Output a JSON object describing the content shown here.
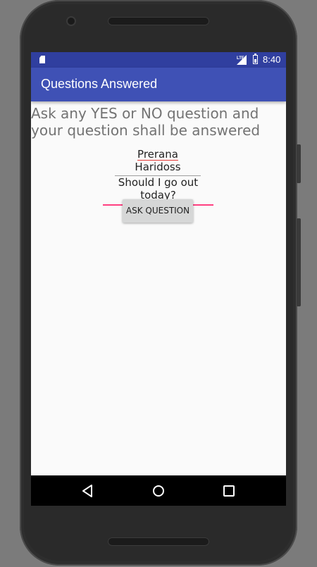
{
  "status_bar": {
    "time": "8:40",
    "network_label": "LTE",
    "icons": [
      "sd-card-icon",
      "lte-signal-icon",
      "battery-icon"
    ]
  },
  "app_bar": {
    "title": "Questions Answered",
    "color": "#3f51b5",
    "status_color": "#303f9f"
  },
  "main": {
    "prompt": "Ask any YES or NO question and your question shall be answered",
    "name_first": "Prerana",
    "name_last": " Haridoss",
    "question_value": "Should I go out today?",
    "ask_button_label": "ASK QUESTION",
    "accent_color": "#ff4081"
  },
  "nav_bar": {
    "buttons": [
      "back-icon",
      "home-icon",
      "recents-icon"
    ]
  }
}
